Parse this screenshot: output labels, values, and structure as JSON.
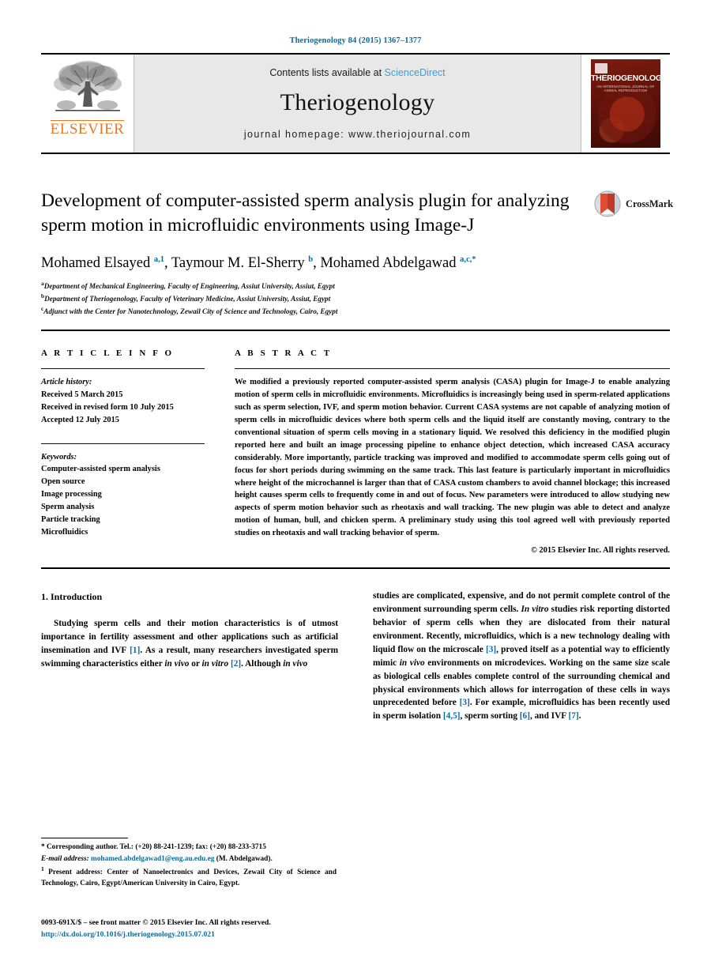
{
  "running_head": "Theriogenology 84 (2015) 1367–1377",
  "masthead": {
    "publisher_logo_word": "ELSEVIER",
    "contents_prefix": "Contents lists available at",
    "contents_provider": "ScienceDirect",
    "journal_name": "Theriogenology",
    "homepage": "journal homepage: www.theriojournal.com",
    "cover_title": "THERIOGENOLOGY",
    "cover_subtitle": "AN INTERNATIONAL JOURNAL OF ANIMAL REPRODUCTION"
  },
  "article": {
    "title": "Development of computer-assisted sperm analysis plugin for analyzing sperm motion in microfluidic environments using Image-J",
    "crossmark_label": "CrossMark",
    "authors_html": "Mohamed Elsayed <sup>a,1</sup>, Taymour M. El-Sherry <sup>b</sup>, Mohamed Abdelgawad <sup>a,c,</sup><sup>*</sup>",
    "affiliations": [
      {
        "marker": "a",
        "text": "Department of Mechanical Engineering, Faculty of Engineering, Assiut University, Assiut, Egypt"
      },
      {
        "marker": "b",
        "text": "Department of Theriogenology, Faculty of Veterinary Medicine, Assiut University, Assiut, Egypt"
      },
      {
        "marker": "c",
        "text": "Adjunct with the Center for Nanotechnology, Zewail City of Science and Technology, Cairo, Egypt"
      }
    ]
  },
  "article_info": {
    "heading": "A R T I C L E   I N F O",
    "history_label": "Article history:",
    "history": [
      "Received 5 March 2015",
      "Received in revised form 10 July 2015",
      "Accepted 12 July 2015"
    ],
    "keywords_label": "Keywords:",
    "keywords": [
      "Computer-assisted sperm analysis",
      "Open source",
      "Image processing",
      "Sperm analysis",
      "Particle tracking",
      "Microfluidics"
    ]
  },
  "abstract": {
    "heading": "A B S T R A C T",
    "text": "We modified a previously reported computer-assisted sperm analysis (CASA) plugin for Image-J to enable analyzing motion of sperm cells in microfluidic environments. Microfluidics is increasingly being used in sperm-related applications such as sperm selection, IVF, and sperm motion behavior. Current CASA systems are not capable of analyzing motion of sperm cells in microfluidic devices where both sperm cells and the liquid itself are constantly moving, contrary to the conventional situation of sperm cells moving in a stationary liquid. We resolved this deficiency in the modified plugin reported here and built an image processing pipeline to enhance object detection, which increased CASA accuracy considerably. More importantly, particle tracking was improved and modified to accommodate sperm cells going out of focus for short periods during swimming on the same track. This last feature is particularly important in microfluidics where height of the microchannel is larger than that of CASA custom chambers to avoid channel blockage; this increased height causes sperm cells to frequently come in and out of focus. New parameters were introduced to allow studying new aspects of sperm motion behavior such as rheotaxis and wall tracking. The new plugin was able to detect and analyze motion of human, bull, and chicken sperm. A preliminary study using this tool agreed well with previously reported studies on rheotaxis and wall tracking behavior of sperm.",
    "copyright": "© 2015 Elsevier Inc. All rights reserved."
  },
  "introduction": {
    "heading": "1. Introduction",
    "left_paragraph_html": "Studying sperm cells and their motion characteristics is of utmost importance in fertility assessment and other applications such as artificial insemination and IVF <span class=\"cite\">[1]</span>. As a result, many researchers investigated sperm swimming characteristics either <span class=\"ital\">in vivo</span> or <span class=\"ital\">in vitro</span> <span class=\"cite\">[2]</span>. Although <span class=\"ital\">in vivo</span>",
    "right_paragraph_html": "studies are complicated, expensive, and do not permit complete control of the environment surrounding sperm cells. <span class=\"ital\">In vitro</span> studies risk reporting distorted behavior of sperm cells when they are dislocated from their natural environment. Recently, microfluidics, which is a new technology dealing with liquid flow on the microscale <span class=\"cite\">[3]</span>, proved itself as a potential way to efficiently mimic <span class=\"ital\">in vivo</span> environments on microdevices. Working on the same size scale as biological cells enables complete control of the surrounding chemical and physical environments which allows for interrogation of these cells in ways unprecedented before <span class=\"cite\">[3]</span>. For example, microfluidics has been recently used in sperm isolation <span class=\"cite\">[4,5]</span>, sperm sorting <span class=\"cite\">[6]</span>, and IVF <span class=\"cite\">[7]</span>."
  },
  "footnotes": {
    "corresponding_html": "* Corresponding author. Tel.: (+20) 88-241-1239; fax: (+20) 88-233-3715",
    "email_label": "E-mail address:",
    "email": "mohamed.abdelgawad1@eng.au.edu.eg",
    "email_suffix": "(M. Abdelgawad).",
    "present_address_html": "<sup>1</sup> Present address: Center of Nanoelectronics and Devices, Zewail City of Science and Technology, Cairo, Egypt/American University in Cairo, Egypt."
  },
  "page_footer": {
    "issn_line": "0093-691X/$ – see front matter © 2015 Elsevier Inc. All rights reserved.",
    "doi": "http://dx.doi.org/10.1016/j.theriogenology.2015.07.021"
  },
  "colors": {
    "link_blue": "#0b6ba0",
    "sciencedirect_blue": "#3a9fd8",
    "elsevier_orange": "#E87722",
    "cover_red": "#7d1c10"
  }
}
